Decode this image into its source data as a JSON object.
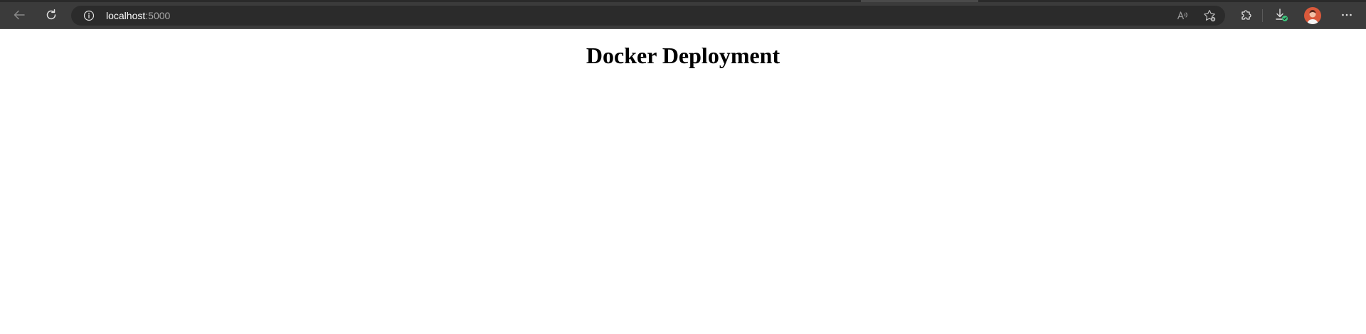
{
  "browser": {
    "address": {
      "host": "localhost",
      "port": ":5000"
    },
    "toolbar_icons": [
      "back-icon",
      "refresh-icon",
      "info-icon",
      "read-aloud-icon",
      "favorite-add-icon",
      "extensions-icon",
      "downloads-icon",
      "profile-avatar",
      "more-icon"
    ]
  },
  "page": {
    "title": "Docker Deployment"
  },
  "colors": {
    "toolbar_bg": "#3b3b3b",
    "address_bg": "#2b2b2b",
    "avatar": "#d9593b",
    "download_badge": "#3cc47c"
  }
}
